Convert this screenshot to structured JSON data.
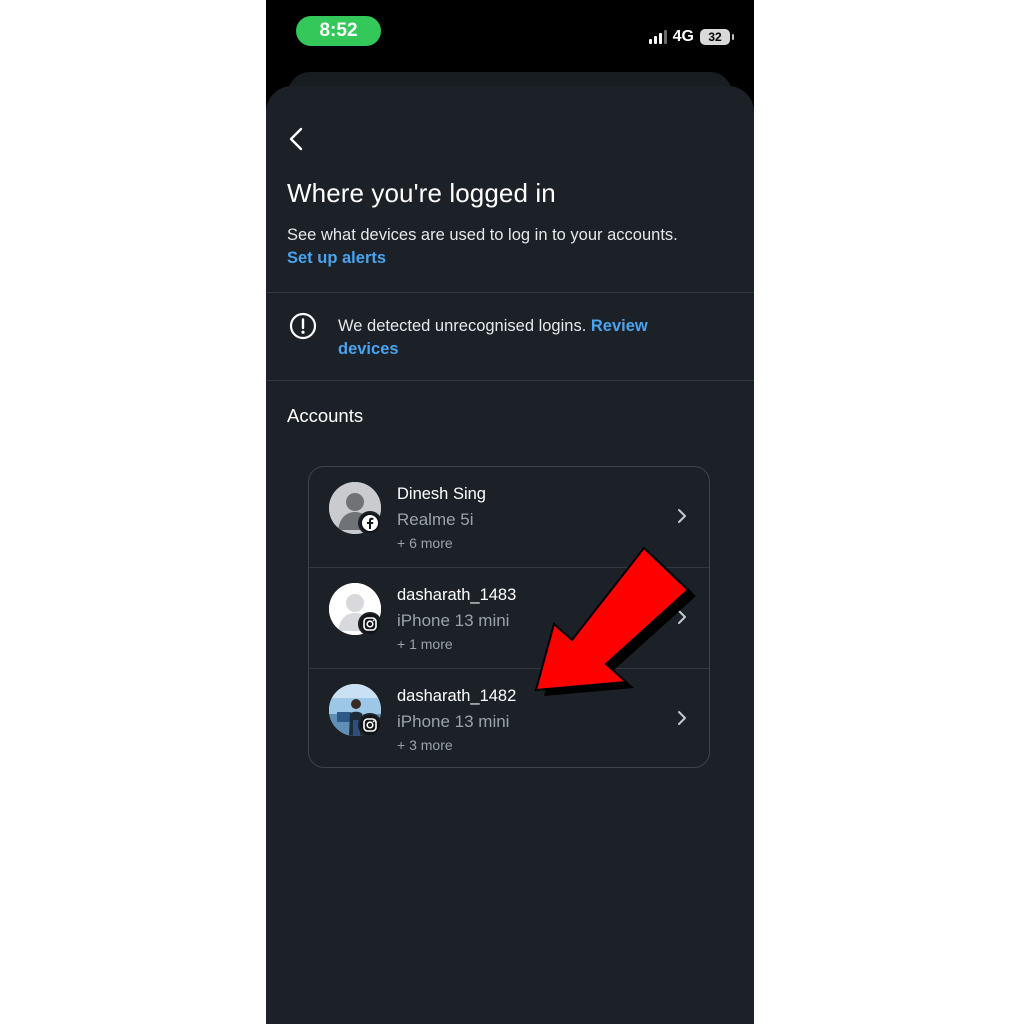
{
  "status_bar": {
    "time": "8:52",
    "network": "4G",
    "battery": "32"
  },
  "page": {
    "title": "Where you're logged in",
    "subtitle": "See what devices are used to log in to your accounts.",
    "alerts_link": "Set up alerts"
  },
  "notice": {
    "text": "We detected unrecognised logins.",
    "link": "Review devices"
  },
  "accounts": {
    "heading": "Accounts",
    "items": [
      {
        "name": "Dinesh Sing",
        "device": "Realme 5i",
        "more": "+ 6 more",
        "platform": "facebook-icon"
      },
      {
        "name": "dasharath_1483",
        "device": "iPhone 13 mini",
        "more": "+ 1 more",
        "platform": "instagram-icon"
      },
      {
        "name": "dasharath_1482",
        "device": "iPhone 13 mini",
        "more": "+ 3 more",
        "platform": "instagram-icon"
      }
    ]
  },
  "colors": {
    "sheet_bg": "#1b2126",
    "link": "#4aa3f0",
    "time_pill": "#34c759",
    "annotation_arrow": "#ff0000"
  }
}
